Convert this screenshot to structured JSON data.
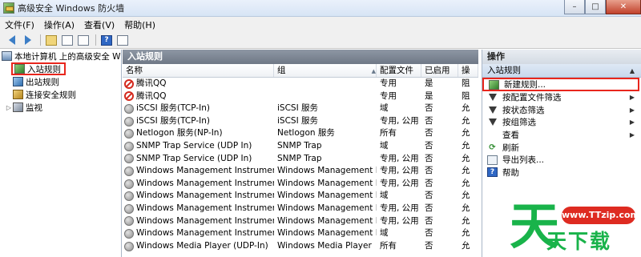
{
  "window": {
    "title": "高级安全 Windows 防火墙",
    "buttons": {
      "minimize": "–",
      "maximize": "□",
      "close": "✕"
    }
  },
  "menu": [
    "文件(F)",
    "操作(A)",
    "查看(V)",
    "帮助(H)"
  ],
  "tree": {
    "root": "本地计算机 上的高级安全 Windows 防火墙",
    "items": [
      "入站规则",
      "出站规则",
      "连接安全规则",
      "监视"
    ]
  },
  "center": {
    "title": "入站规则",
    "columns": [
      "名称",
      "组",
      "配置文件",
      "已启用",
      "操"
    ],
    "rows": [
      {
        "icon": "blocked-icon",
        "name": "腾讯QQ",
        "group": "",
        "profile": "专用",
        "enabled": "是",
        "action": "阻"
      },
      {
        "icon": "blocked-icon",
        "name": "腾讯QQ",
        "group": "",
        "profile": "专用",
        "enabled": "是",
        "action": "阻"
      },
      {
        "icon": "disabled-rule-icon",
        "name": "iSCSI 服务(TCP-In)",
        "group": "iSCSI 服务",
        "profile": "域",
        "enabled": "否",
        "action": "允"
      },
      {
        "icon": "disabled-rule-icon",
        "name": "iSCSI 服务(TCP-In)",
        "group": "iSCSI 服务",
        "profile": "专用, 公用",
        "enabled": "否",
        "action": "允"
      },
      {
        "icon": "disabled-rule-icon",
        "name": "Netlogon 服务(NP-In)",
        "group": "Netlogon 服务",
        "profile": "所有",
        "enabled": "否",
        "action": "允"
      },
      {
        "icon": "disabled-rule-icon",
        "name": "SNMP Trap Service (UDP In)",
        "group": "SNMP Trap",
        "profile": "域",
        "enabled": "否",
        "action": "允"
      },
      {
        "icon": "disabled-rule-icon",
        "name": "SNMP Trap Service (UDP In)",
        "group": "SNMP Trap",
        "profile": "专用, 公用",
        "enabled": "否",
        "action": "允"
      },
      {
        "icon": "disabled-rule-icon",
        "name": "Windows Management Instrumentati...",
        "group": "Windows Management In...",
        "profile": "专用, 公用",
        "enabled": "否",
        "action": "允"
      },
      {
        "icon": "disabled-rule-icon",
        "name": "Windows Management Instrumentati...",
        "group": "Windows Management In...",
        "profile": "专用, 公用",
        "enabled": "否",
        "action": "允"
      },
      {
        "icon": "disabled-rule-icon",
        "name": "Windows Management Instrumentati...",
        "group": "Windows Management In...",
        "profile": "域",
        "enabled": "否",
        "action": "允"
      },
      {
        "icon": "disabled-rule-icon",
        "name": "Windows Management Instrumentati...",
        "group": "Windows Management In...",
        "profile": "专用, 公用",
        "enabled": "否",
        "action": "允"
      },
      {
        "icon": "disabled-rule-icon",
        "name": "Windows Management Instrumentati...",
        "group": "Windows Management In...",
        "profile": "专用, 公用",
        "enabled": "否",
        "action": "允"
      },
      {
        "icon": "disabled-rule-icon",
        "name": "Windows Management Instrumentati...",
        "group": "Windows Management In...",
        "profile": "域",
        "enabled": "否",
        "action": "允"
      },
      {
        "icon": "disabled-rule-icon",
        "name": "Windows Media Player (UDP-In)",
        "group": "Windows Media Player",
        "profile": "所有",
        "enabled": "否",
        "action": "允"
      }
    ]
  },
  "actions": {
    "title": "操作",
    "section": "入站规则",
    "items": [
      {
        "label": "新建规则...",
        "icon": "new-rule-icon",
        "more": false
      },
      {
        "label": "按配置文件筛选",
        "icon": "filter-icon",
        "more": true
      },
      {
        "label": "按状态筛选",
        "icon": "filter-icon",
        "more": true
      },
      {
        "label": "按组筛选",
        "icon": "filter-icon",
        "more": true
      },
      {
        "label": "查看",
        "icon": "",
        "more": true
      },
      {
        "label": "刷新",
        "icon": "refresh-icon",
        "more": false
      },
      {
        "label": "导出列表...",
        "icon": "export-icon",
        "more": false
      },
      {
        "label": "帮助",
        "icon": "help-icon",
        "more": false
      }
    ]
  },
  "watermark": {
    "url": "www.TTzip.com",
    "logo": "天",
    "text": "天下载"
  },
  "colors": {
    "highlight_box": "#e8261d",
    "header_dark": "#6f7886",
    "watermark_green": "#19b34a",
    "watermark_red": "#de2b21"
  }
}
